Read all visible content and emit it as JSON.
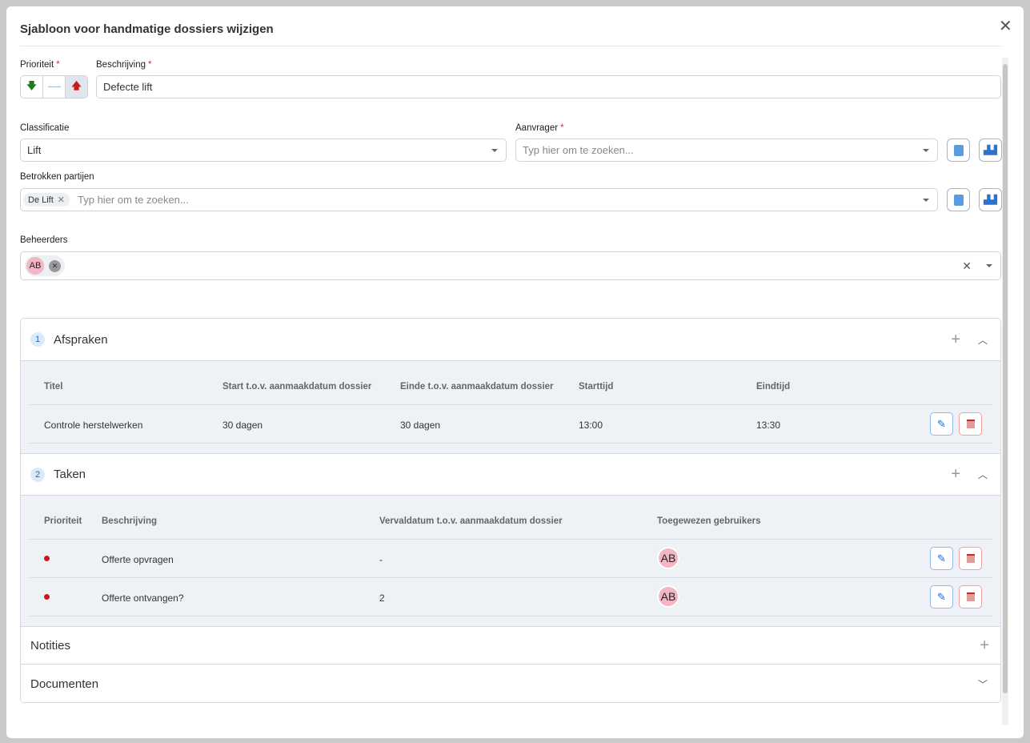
{
  "dialog": {
    "title": "Sjabloon voor handmatige dossiers wijzigen"
  },
  "form": {
    "priority": {
      "label": "Prioriteit",
      "required": "*"
    },
    "description": {
      "label": "Beschrijving",
      "required": "*",
      "value": "Defecte lift"
    },
    "classification": {
      "label": "Classificatie",
      "value": "Lift"
    },
    "requester": {
      "label": "Aanvrager",
      "required": "*",
      "placeholder": "Typ hier om te zoeken..."
    },
    "parties": {
      "label": "Betrokken partijen",
      "chip": "De Lift",
      "placeholder": "Typ hier om te zoeken..."
    },
    "managers": {
      "label": "Beheerders",
      "chip": "AB"
    }
  },
  "appointments": {
    "number": "1",
    "title": "Afspraken",
    "columns": [
      "Titel",
      "Start t.o.v. aanmaakdatum dossier",
      "Einde t.o.v. aanmaakdatum dossier",
      "Starttijd",
      "Eindtijd"
    ],
    "rows": [
      {
        "title": "Controle herstelwerken",
        "start": "30 dagen",
        "end": "30 dagen",
        "start_time": "13:00",
        "end_time": "13:30"
      }
    ]
  },
  "tasks": {
    "number": "2",
    "title": "Taken",
    "columns": [
      "Prioriteit",
      "Beschrijving",
      "Vervaldatum t.o.v. aanmaakdatum dossier",
      "Toegewezen gebruikers"
    ],
    "rows": [
      {
        "description": "Offerte opvragen",
        "due": "-",
        "user": "AB"
      },
      {
        "description": "Offerte ontvangen?",
        "due": "2",
        "user": "AB"
      }
    ]
  },
  "notes": {
    "title": "Notities"
  },
  "documents": {
    "title": "Documenten"
  }
}
